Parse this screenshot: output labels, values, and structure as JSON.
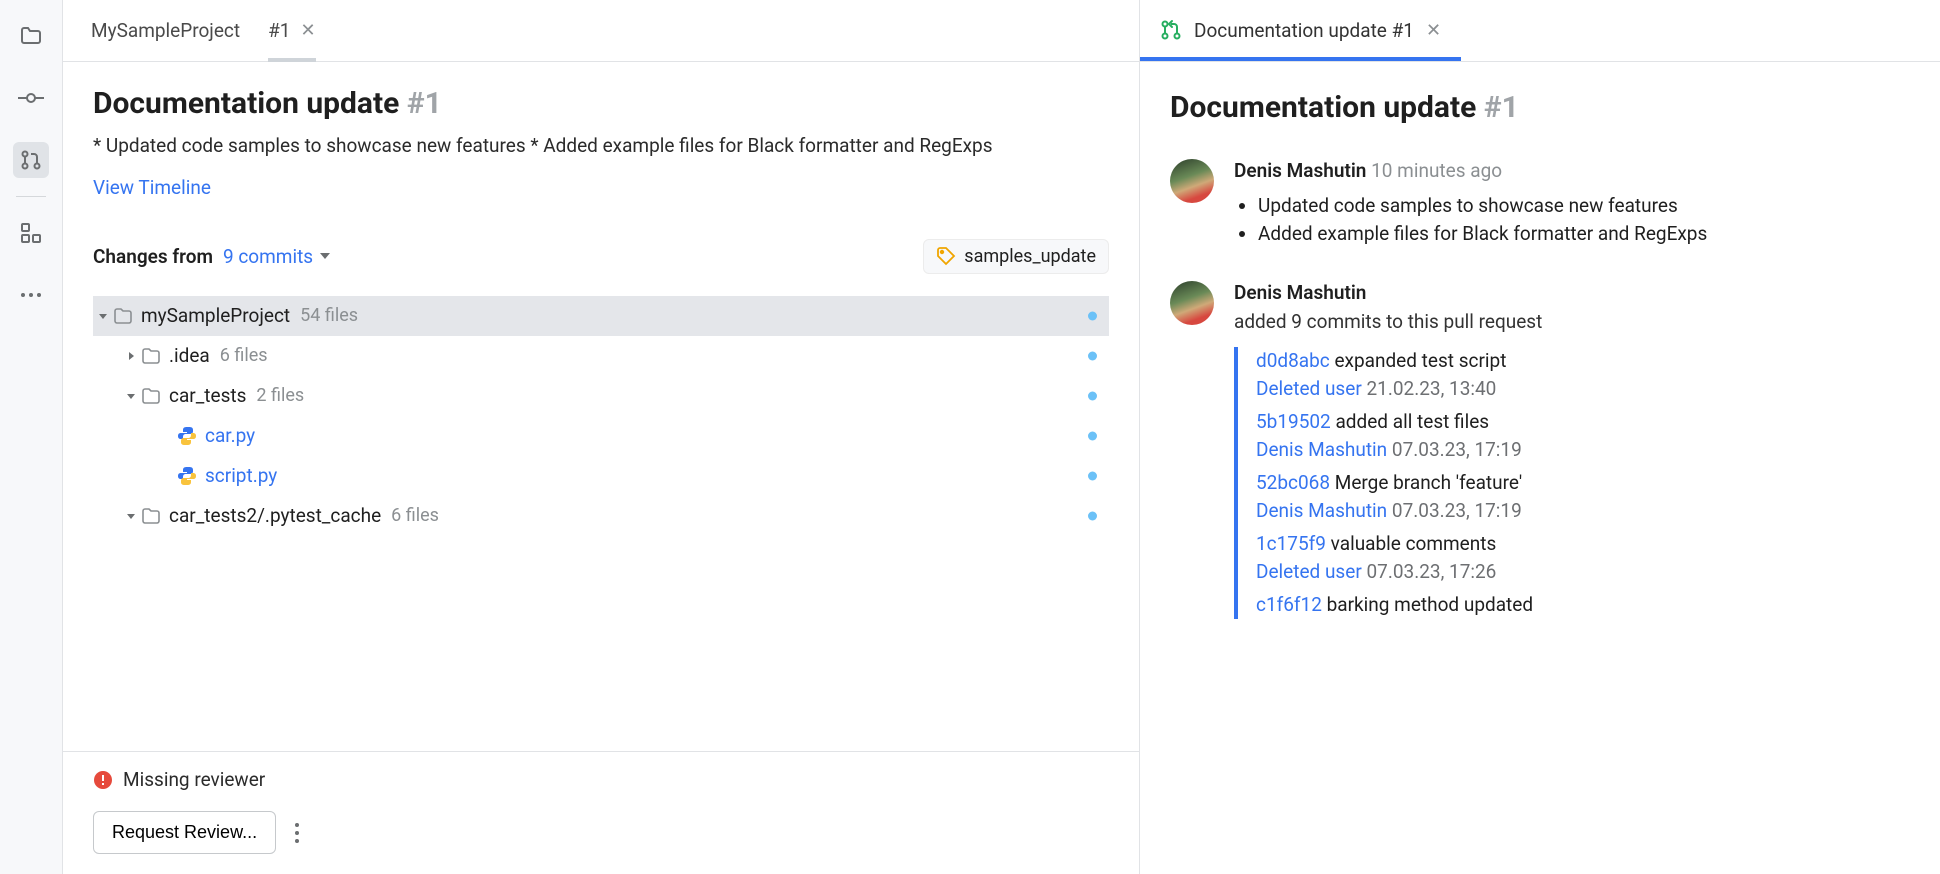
{
  "rail": {
    "items": [
      {
        "name": "project-icon",
        "selected": false
      },
      {
        "name": "commit-icon",
        "selected": false
      },
      {
        "name": "pull-requests-icon",
        "selected": true
      },
      {
        "name": "structure-icon",
        "selected": false
      },
      {
        "name": "more-icon",
        "selected": false
      }
    ]
  },
  "left": {
    "tabs": [
      {
        "label": "MySampleProject",
        "closable": false,
        "selected": false
      },
      {
        "label": "#1",
        "closable": true,
        "selected": true
      }
    ],
    "pr": {
      "title": "Documentation update",
      "number": "#1",
      "description": "* Updated code samples to showcase new features * Added example files for Black formatter and RegExps",
      "view_timeline": "View Timeline"
    },
    "changes": {
      "label": "Changes from",
      "commits_label": "9 commits",
      "branch": "samples_update"
    },
    "tree": [
      {
        "kind": "folder",
        "name": "mySampleProject",
        "meta": "54 files",
        "indent": 0,
        "expanded": true,
        "selected": true,
        "dot": true
      },
      {
        "kind": "folder",
        "name": ".idea",
        "meta": "6 files",
        "indent": 1,
        "expanded": false,
        "dot": true
      },
      {
        "kind": "folder",
        "name": "car_tests",
        "meta": "2 files",
        "indent": 1,
        "expanded": true,
        "dot": true
      },
      {
        "kind": "py",
        "name": "car.py",
        "indent": 3,
        "dot": true
      },
      {
        "kind": "py",
        "name": "script.py",
        "indent": 3,
        "dot": true
      },
      {
        "kind": "folder",
        "name": "car_tests2/.pytest_cache",
        "meta": "6 files",
        "indent": 1,
        "expanded": true,
        "dot": true
      }
    ],
    "missing_reviewer": "Missing reviewer",
    "request_review": "Request Review..."
  },
  "right": {
    "tab": {
      "label": "Documentation update #1"
    },
    "title": "Documentation update",
    "number": "#1",
    "events": [
      {
        "author": "Denis Mashutin",
        "time": "10 minutes ago",
        "bullets": [
          "Updated code samples to showcase new features",
          "Added example files for Black formatter and RegExps"
        ]
      }
    ],
    "commit_event": {
      "author": "Denis Mashutin",
      "sub": "added 9 commits to this pull request",
      "commits": [
        {
          "hash": "d0d8abc",
          "msg": "expanded test script",
          "user": "Deleted user",
          "date": "21.02.23, 13:40"
        },
        {
          "hash": "5b19502",
          "msg": "added all test files",
          "user": "Denis Mashutin",
          "date": "07.03.23, 17:19"
        },
        {
          "hash": "52bc068",
          "msg": "Merge branch 'feature'",
          "user": "Denis Mashutin",
          "date": "07.03.23, 17:19"
        },
        {
          "hash": "1c175f9",
          "msg": "valuable comments",
          "user": "Deleted user",
          "date": "07.03.23, 17:26"
        },
        {
          "hash": "c1f6f12",
          "msg": "barking method updated",
          "user": "",
          "date": ""
        }
      ]
    }
  }
}
